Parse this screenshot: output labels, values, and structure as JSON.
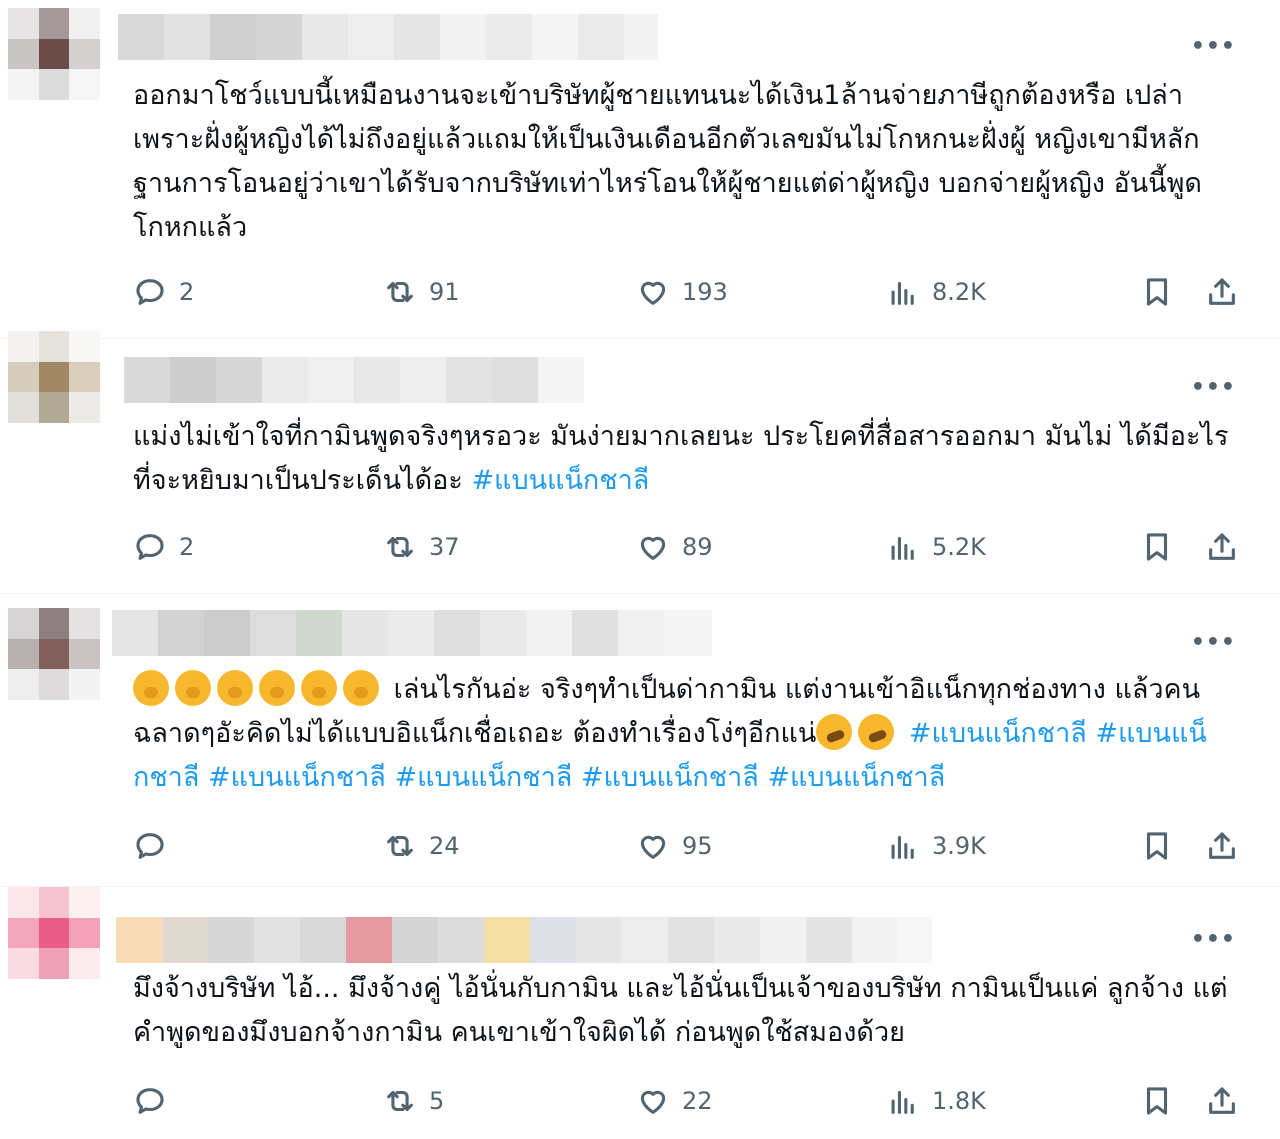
{
  "tweets": [
    {
      "body": "ออกมาโชว์แบบนี้เหมือนงานจะเข้าบริษัทผู้ชายแทนนะได้เงิน1ล้านจ่ายภาษีถูกต้องหรือ เปล่าเพราะฝั่งผู้หญิงได้ไม่ถึงอยู่แล้วแถมให้เป็นเงินเดือนอีกตัวเลขมันไม่โกหกนะฝั่งผู้ หญิงเขามีหลักฐานการโอนอยู่ว่าเขาได้รับจากบริษัทเท่าไหร่โอนให้ผู้ชายแต่ด่าผู้หญิง บอกจ่ายผู้หญิง อันนี้พูดโกหกแล้ว",
      "replies": "2",
      "reposts": "91",
      "likes": "193",
      "views": "8.2K"
    },
    {
      "body": "แม่งไม่เข้าใจที่กามินพูดจริงๆหรอวะ มันง่ายมากเลยนะ ประโยคที่สื่อสารออกมา มันไม่ ได้มีอะไรที่จะหยิบมาเป็นประเด็นได้อะ ",
      "hashtag": "#แบนแน็กชาลี",
      "replies": "2",
      "reposts": "37",
      "likes": "89",
      "views": "5.2K"
    },
    {
      "body_a": "เล่นไรกันอ่ะ จริงๆทำเป็นด่ากามิน แต่งานเข้าอิแน็กทุกช่องทาง แล้วคนฉลาดๆอัะคิดไม่ได้แบบอิแน็กเชื่อเถอะ ต้องทำเรื่องโง่ๆอีกแน่",
      "hashtags": [
        "#แบนแน็กชาลี",
        "#แบนแน็กชาลี",
        "#แบนแน็กชาลี",
        "#แบนแน็กชาลี",
        "#แบนแน็กชาลี",
        "#แบนแน็กชาลี"
      ],
      "emoji_lead": "hand-over-mouth-emoji",
      "emoji_trail": "rolling-laughing-emoji",
      "replies": "",
      "reposts": "24",
      "likes": "95",
      "views": "3.9K"
    },
    {
      "body": "มึงจ้างบริษัท ไอ้... มึงจ้างคู่ ไอ้นั่นกับกามิน และไอ้นั่นเป็นเจ้าของบริษัท กามินเป็นแค่ ลูกจ้าง แต่คำพูดของมึงบอกจ้างกามิน คนเขาเข้าใจผิดได้ ก่อนพูดใช้สมองด้วย",
      "replies": "",
      "reposts": "5",
      "likes": "22",
      "views": "1.8K"
    }
  ],
  "icons": {
    "more": "more-icon",
    "reply": "reply-icon",
    "repost": "repost-icon",
    "like": "heart-icon",
    "views": "views-icon",
    "bookmark": "bookmark-icon",
    "share": "share-icon"
  },
  "colors": {
    "text": "#0f1419",
    "muted": "#536471",
    "link": "#1d9bf0",
    "divider": "#eff3f4"
  },
  "more_label": "•••"
}
